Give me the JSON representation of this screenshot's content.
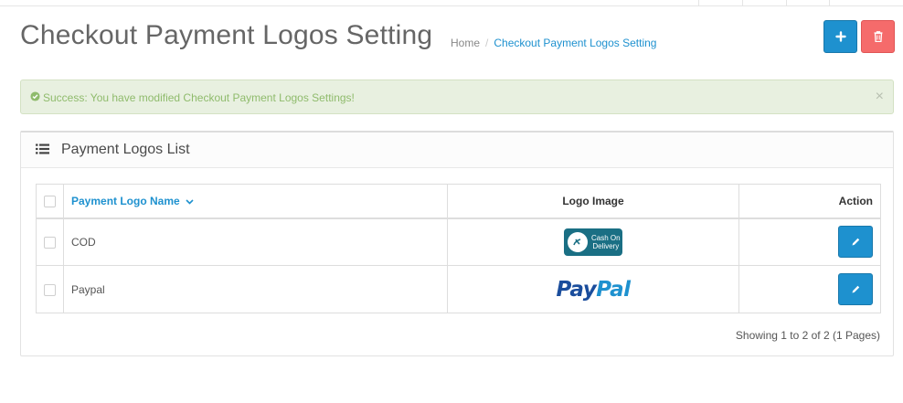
{
  "header": {
    "title": "Checkout Payment Logos Setting",
    "breadcrumb": {
      "home": "Home",
      "separator": "/",
      "current": "Checkout Payment Logos Setting"
    },
    "add_icon": "plus-icon",
    "delete_icon": "trash-icon"
  },
  "alert": {
    "message": "Success: You have modified Checkout Payment Logos Settings!",
    "close": "×",
    "icon": "check-circle-icon"
  },
  "panel": {
    "title": "Payment Logos List",
    "icon": "list-icon"
  },
  "table": {
    "columns": {
      "name": "Payment Logo Name",
      "logo": "Logo Image",
      "action": "Action"
    },
    "rows": [
      {
        "name": "COD",
        "logo_text": "Cash On Delivery",
        "logo_line1": "Cash On",
        "logo_line2": "Delivery"
      },
      {
        "name": "Paypal",
        "logo_text": "PayPal",
        "logo_pay": "Pay",
        "logo_pal": "Pal"
      }
    ]
  },
  "pagination": {
    "summary": "Showing 1 to 2 of 2 (1 Pages)"
  },
  "colors": {
    "primary": "#1e91cf",
    "danger": "#f56b6b",
    "success_bg": "#e8f0e0",
    "success_text": "#8fbb6c"
  }
}
